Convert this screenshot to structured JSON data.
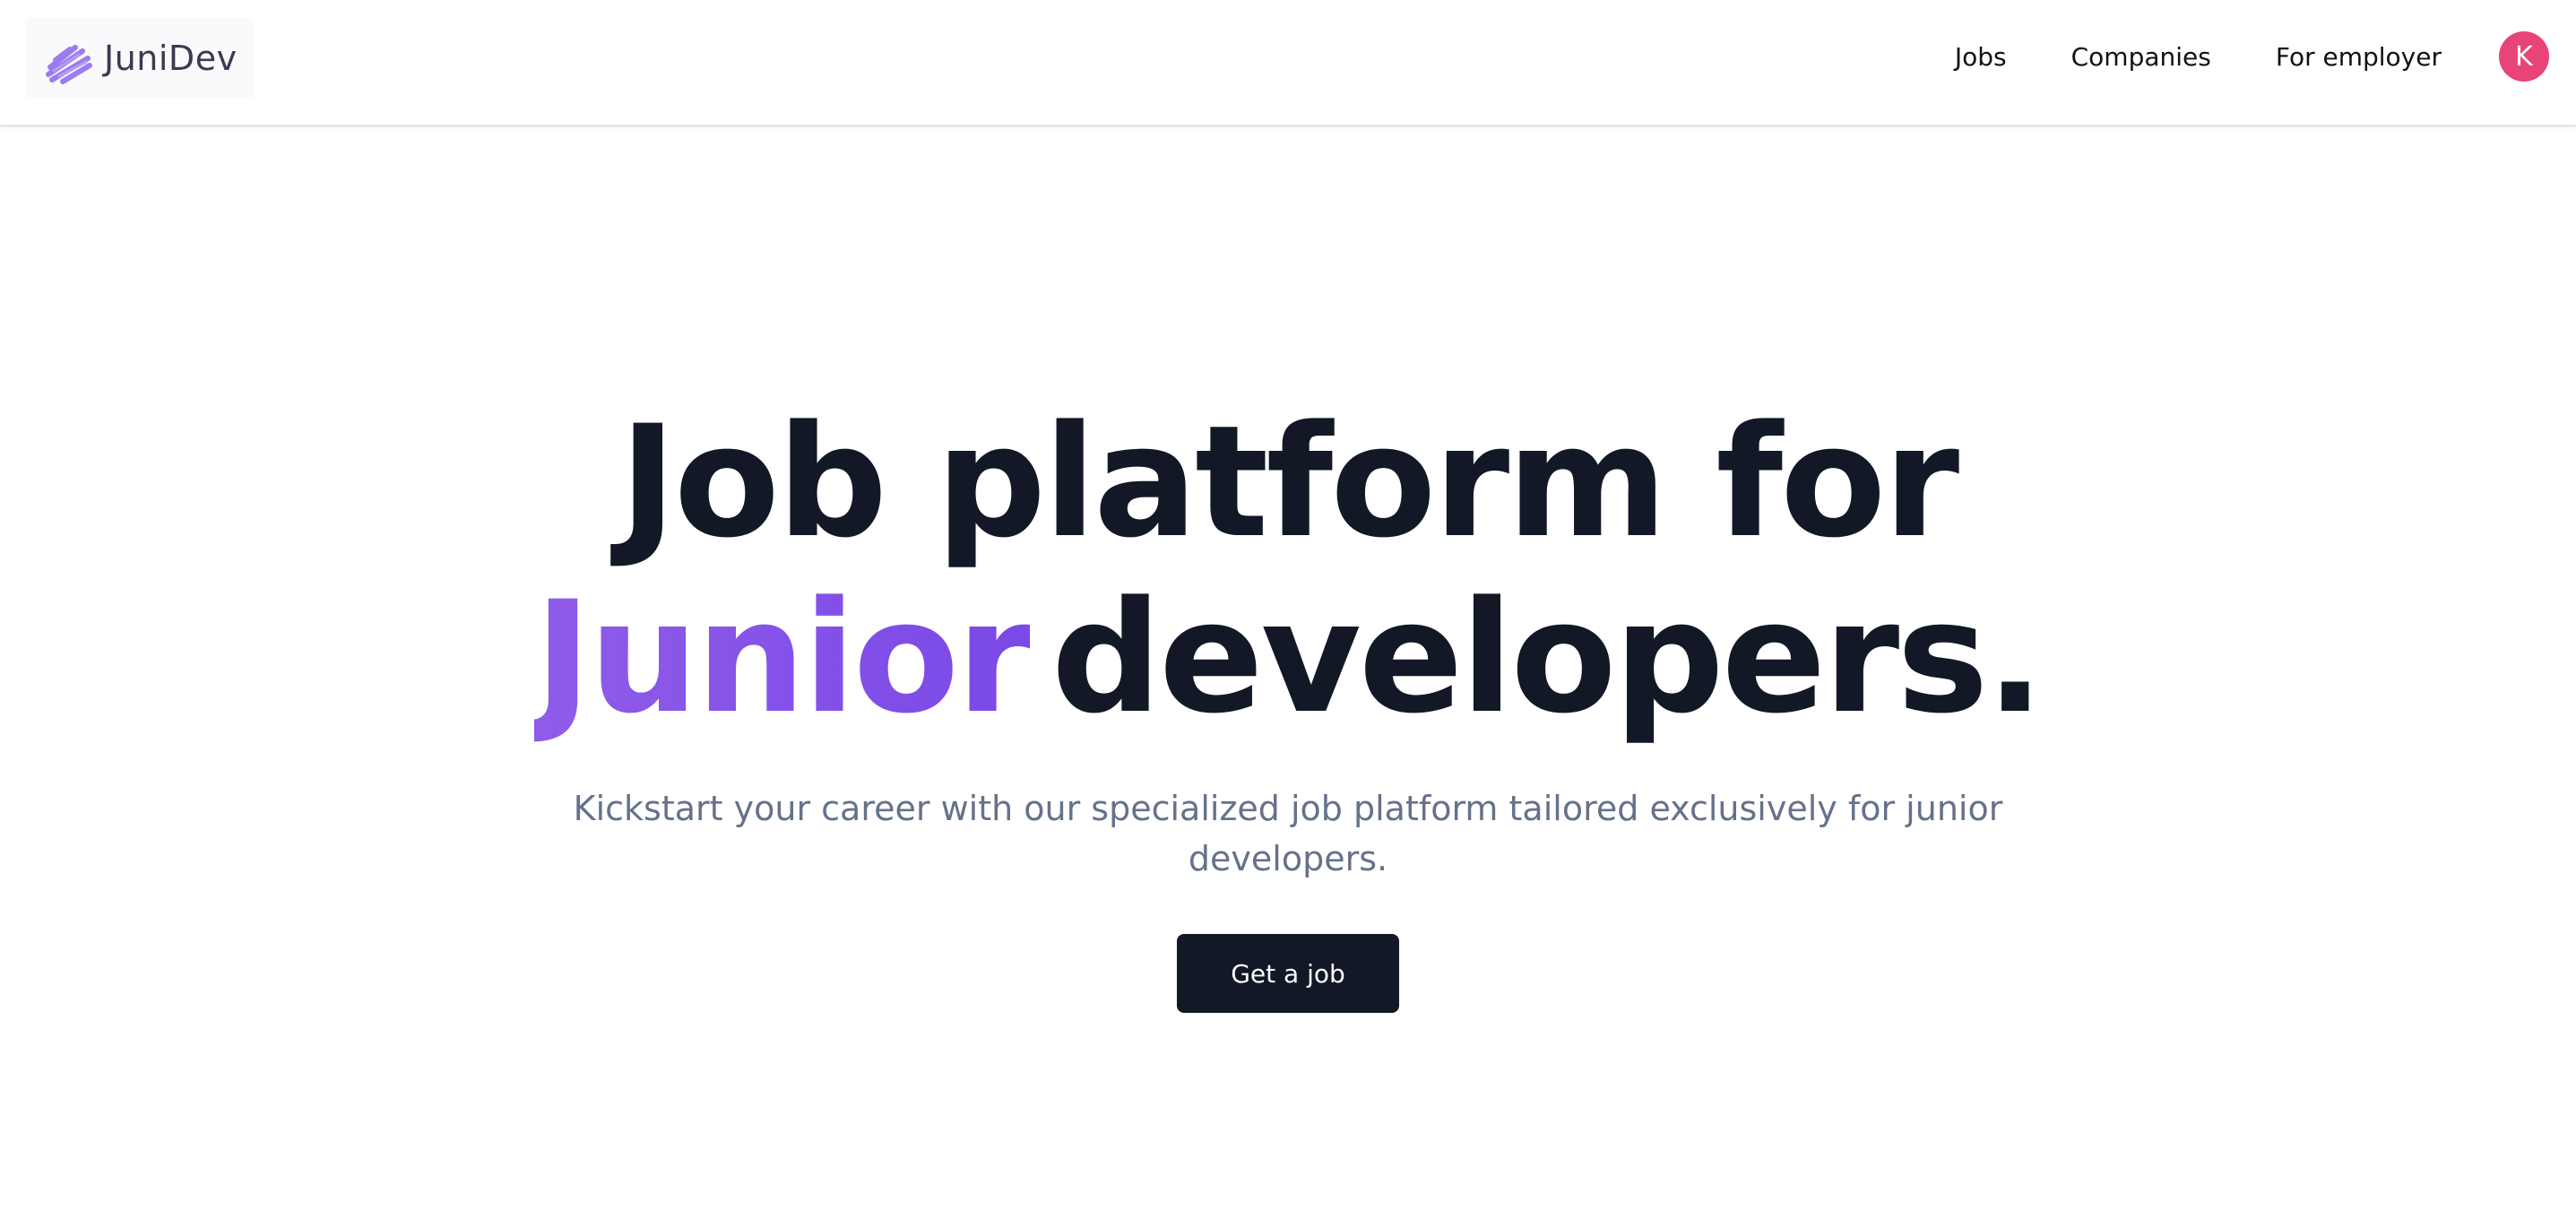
{
  "brand": {
    "name": "JuniDev",
    "logo_icon": "brush-stroke-icon"
  },
  "nav": {
    "items": [
      {
        "label": "Jobs"
      },
      {
        "label": "Companies"
      },
      {
        "label": "For employer"
      }
    ],
    "avatar_initial": "K"
  },
  "hero": {
    "headline_line1": "Job platform for",
    "headline_highlight": "Junior",
    "headline_line2_rest": "developers.",
    "subtitle": "Kickstart your career with our specialized job platform tailored exclusively for junior developers.",
    "cta_label": "Get a job"
  },
  "colors": {
    "accent": "#8557ea",
    "accent_underline": "#c9b5f7",
    "heading": "#121826",
    "subtitle": "#64728a",
    "avatar_bg": "#e84477",
    "button_bg": "#121826"
  }
}
